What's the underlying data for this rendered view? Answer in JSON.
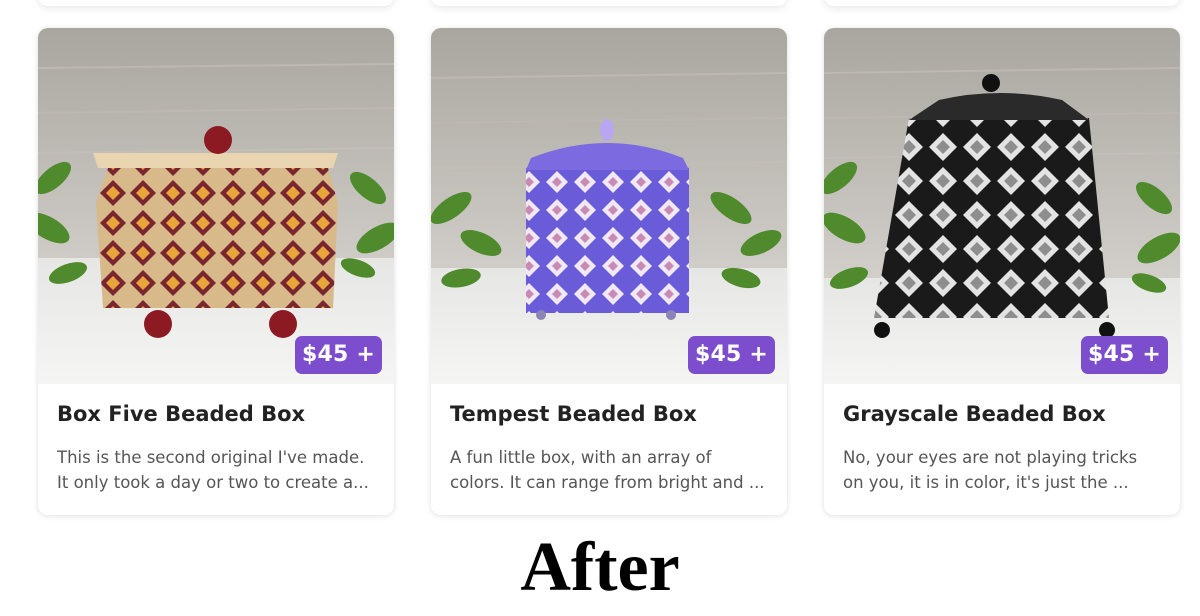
{
  "colors": {
    "badge_bg": "#7c4dcc",
    "title_text": "#222222",
    "desc_text": "#555555"
  },
  "products": [
    {
      "title": "Box Five Beaded Box",
      "price": "$45 +",
      "description_lines": [
        "This is the second original I've made.",
        "It only took a day or two to create a..."
      ]
    },
    {
      "title": "Tempest Beaded Box",
      "price": "$45 +",
      "description_lines": [
        "A fun little box, with an array of",
        "colors. It can range from bright and ..."
      ]
    },
    {
      "title": "Grayscale Beaded Box",
      "price": "$45 +",
      "description_lines": [
        "No, your eyes are not playing tricks",
        "on you, it is in color, it's just the ..."
      ]
    }
  ],
  "caption": "After"
}
